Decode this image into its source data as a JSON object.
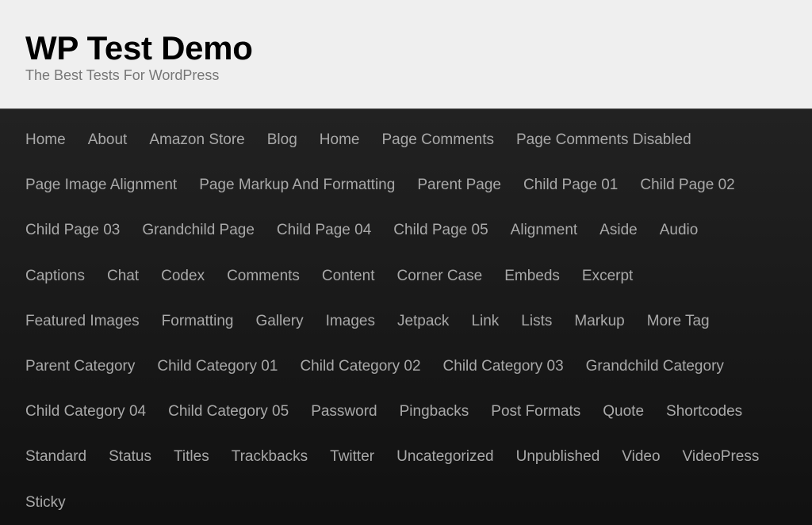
{
  "header": {
    "title": "WP Test Demo",
    "tagline": "The Best Tests For WordPress"
  },
  "menu": {
    "items": [
      "Home",
      "About",
      "Amazon Store",
      "Blog",
      "Home",
      "Page Comments",
      "Page Comments Disabled",
      "Page Image Alignment",
      "Page Markup And Formatting",
      "Parent Page",
      "Child Page 01",
      "Child Page 02",
      "Child Page 03",
      "Grandchild Page",
      "Child Page 04",
      "Child Page 05",
      "Alignment",
      "Aside",
      "Audio",
      "Captions",
      "Chat",
      "Codex",
      "Comments",
      "Content",
      "Corner Case",
      "Embeds",
      "Excerpt",
      "Featured Images",
      "Formatting",
      "Gallery",
      "Images",
      "Jetpack",
      "Link",
      "Lists",
      "Markup",
      "More Tag",
      "Parent Category",
      "Child Category 01",
      "Child Category 02",
      "Child Category 03",
      "Grandchild Category",
      "Child Category 04",
      "Child Category 05",
      "Password",
      "Pingbacks",
      "Post Formats",
      "Quote",
      "Shortcodes",
      "Standard",
      "Status",
      "Titles",
      "Trackbacks",
      "Twitter",
      "Uncategorized",
      "Unpublished",
      "Video",
      "VideoPress",
      "Sticky"
    ]
  }
}
